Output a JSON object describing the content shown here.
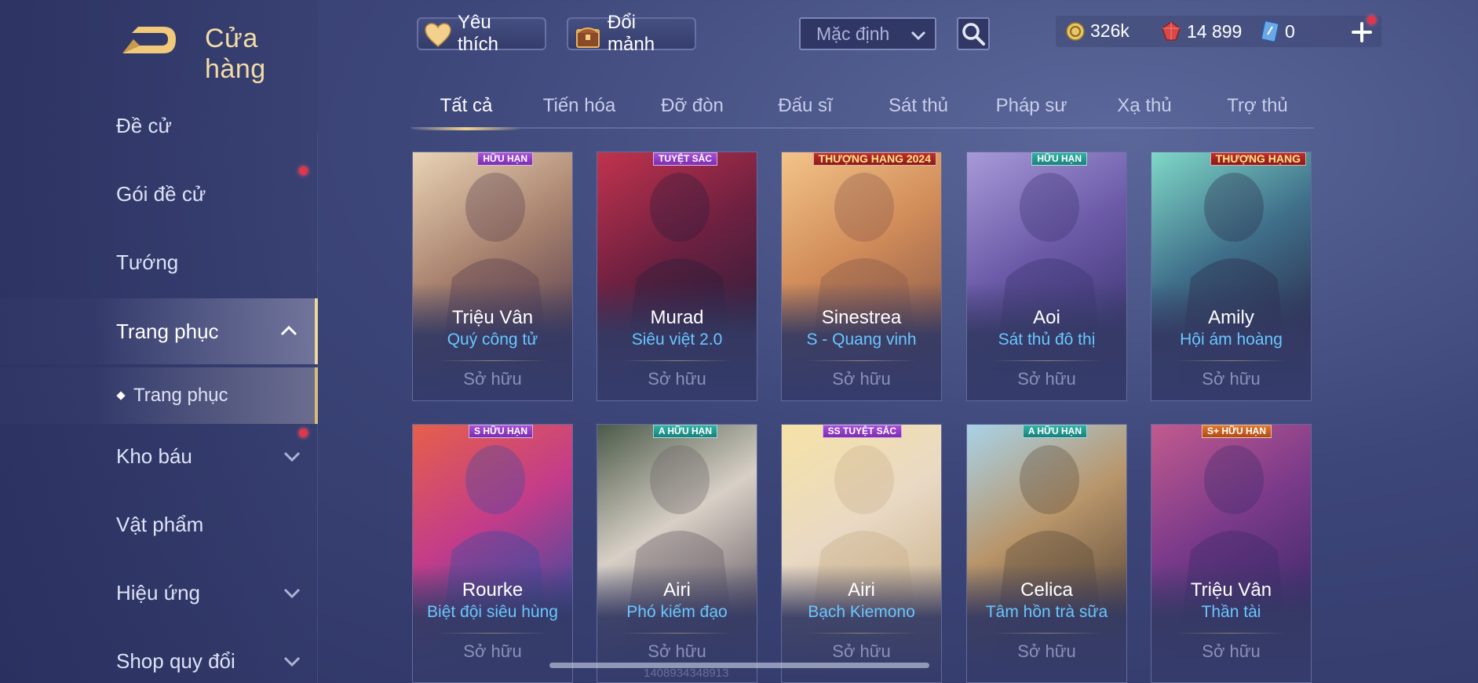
{
  "header": {
    "title": "Cửa hàng",
    "favorites_label": "Yêu thích",
    "exchange_label": "Đổi mảnh",
    "sort_value": "Mặc định"
  },
  "currency": {
    "gold": "326k",
    "vouchers": "14 899",
    "tickets": "0"
  },
  "sidebar": {
    "items": [
      {
        "label": "Đề cử"
      },
      {
        "label": "Gói đề cử"
      },
      {
        "label": "Tướng"
      },
      {
        "label": "Trang phục"
      },
      {
        "label": "Trang phục"
      },
      {
        "label": "Kho báu"
      },
      {
        "label": "Vật phẩm"
      },
      {
        "label": "Hiệu ứng"
      },
      {
        "label": "Shop quy đổi"
      }
    ]
  },
  "tabs": [
    {
      "label": "Tất cả"
    },
    {
      "label": "Tiến hóa"
    },
    {
      "label": "Đỡ đòn"
    },
    {
      "label": "Đấu sĩ"
    },
    {
      "label": "Sát thủ"
    },
    {
      "label": "Pháp sư"
    },
    {
      "label": "Xạ thủ"
    },
    {
      "label": "Trợ thủ"
    }
  ],
  "cards": [
    {
      "hero": "Triệu Vân",
      "skin": "Quý công tử",
      "status": "Sở hữu",
      "badge": "HỮU HẠN",
      "badge_color": "purple",
      "palette": [
        "#e9d3b5",
        "#a9836f",
        "#5a3f4f"
      ]
    },
    {
      "hero": "Murad",
      "skin": "Siêu việt 2.0",
      "status": "Sở hữu",
      "badge": "TUYỆT SẮC",
      "badge_color": "purple",
      "palette": [
        "#c1334d",
        "#6e2040",
        "#2b1e3b"
      ]
    },
    {
      "hero": "Sinestrea",
      "skin": "S - Quang vinh",
      "status": "Sở hữu",
      "badge": "THƯỢNG HẠNG 2024",
      "badge_color": "red",
      "palette": [
        "#f3c48a",
        "#d08b59",
        "#8a5a4a"
      ]
    },
    {
      "hero": "Aoi",
      "skin": "Sát thủ đô thị",
      "status": "Sở hữu",
      "badge": "HỮU HẠN",
      "badge_color": "teal",
      "palette": [
        "#a79ad8",
        "#6c5aa8",
        "#3c3570"
      ]
    },
    {
      "hero": "Amily",
      "skin": "Hội ám hoàng",
      "status": "Sở hữu",
      "badge": "THƯỢNG HẠNG",
      "badge_color": "red",
      "palette": [
        "#7fd8c7",
        "#3f6f8a",
        "#2b2a4a"
      ]
    },
    {
      "hero": "Rourke",
      "skin": "Biệt đội siêu hùng",
      "status": "Sở hữu",
      "badge": "S HỮU HẠN",
      "badge_color": "purple",
      "palette": [
        "#e5604a",
        "#c33c8a",
        "#3a4aa0"
      ]
    },
    {
      "hero": "Airi",
      "skin": "Phó kiếm đạo",
      "status": "Sở hữu",
      "badge": "A HỮU HẠN",
      "badge_color": "teal",
      "palette": [
        "#4b5a4a",
        "#d8d0c6",
        "#6a6068"
      ]
    },
    {
      "hero": "Airi",
      "skin": "Bạch Kiemono",
      "status": "Sở hữu",
      "badge": "SS TUYỆT SẮC",
      "badge_color": "purple",
      "palette": [
        "#f6e2a6",
        "#e9d9c4",
        "#c9b08a"
      ]
    },
    {
      "hero": "Celica",
      "skin": "Tâm hồn trà sữa",
      "status": "Sở hữu",
      "badge": "A HỮU HẠN",
      "badge_color": "teal",
      "palette": [
        "#a8d2e8",
        "#b8956a",
        "#5c4a3a"
      ]
    },
    {
      "hero": "Triệu Vân",
      "skin": "Thần tài",
      "status": "Sở hữu",
      "badge": "S+ HỮU HẠN",
      "badge_color": "orange",
      "palette": [
        "#c25a8e",
        "#7a3a8a",
        "#3b2a6a"
      ]
    }
  ],
  "footer": {
    "id_watermark": "1408934348913"
  },
  "colors": {
    "accent_gold": "#f0d28c",
    "skin_name_blue": "#69c6ff",
    "notification_red": "#e0354a"
  }
}
